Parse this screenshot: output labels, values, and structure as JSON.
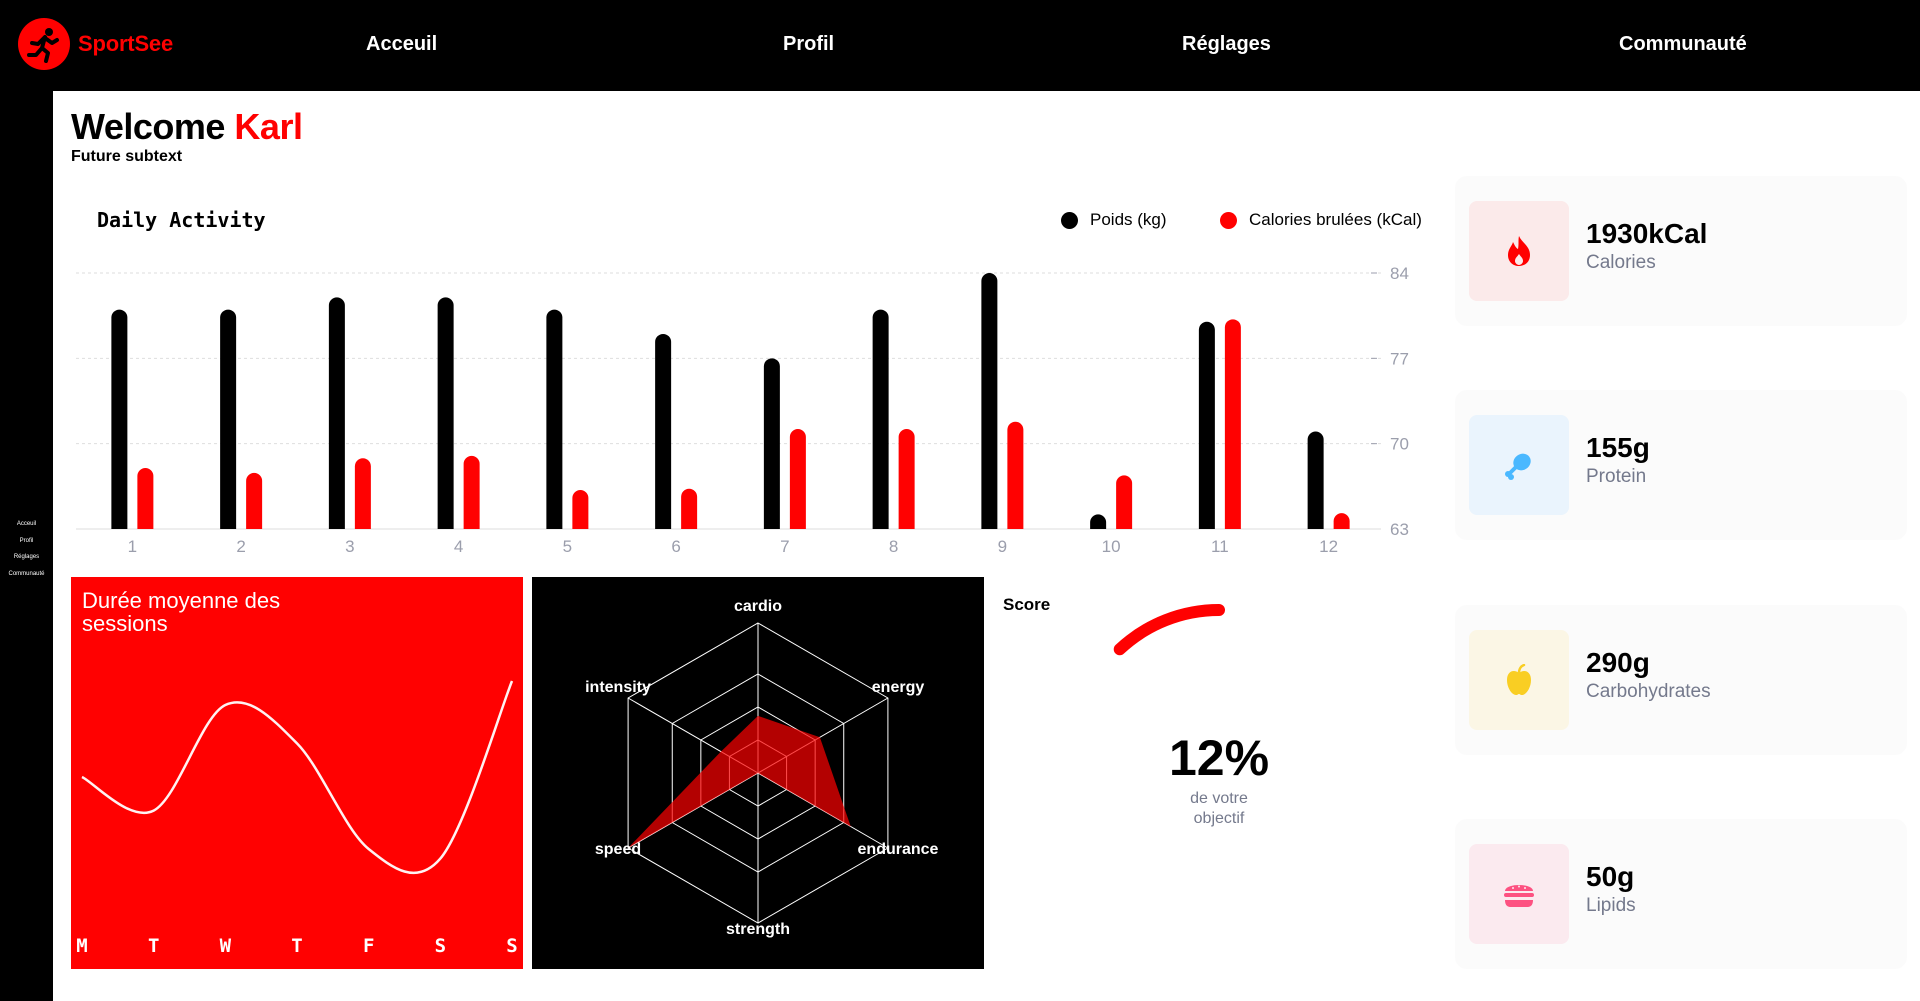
{
  "brand": {
    "name": "SportSee"
  },
  "nav": {
    "items": [
      "Acceuil",
      "Profil",
      "Réglages",
      "Communauté"
    ]
  },
  "sidebar": {
    "items": [
      "Acceuil",
      "Profil",
      "Réglages",
      "Communauté"
    ]
  },
  "header": {
    "welcome": "Welcome",
    "name": "Karl",
    "subtext": "Future subtext"
  },
  "colors": {
    "accent": "#ff0101",
    "dark": "#000000",
    "muted": "#74798c"
  },
  "activity": {
    "title": "Daily Activity",
    "legend": {
      "weight": "Poids (kg)",
      "calories": "Calories brulées (kCal)"
    }
  },
  "sessions": {
    "title": "Durée moyenne des sessions"
  },
  "score": {
    "title": "Score",
    "value": "12%",
    "caption_line1": "de votre",
    "caption_line2": "objectif",
    "fraction": 0.12
  },
  "key_data": [
    {
      "value": "1930kCal",
      "label": "Calories",
      "icon": "flame-icon",
      "color": "#ff0000",
      "bg": "#fbeaea"
    },
    {
      "value": "155g",
      "label": "Protein",
      "icon": "chicken-icon",
      "color": "#4ab8ff",
      "bg": "#eaf4fd"
    },
    {
      "value": "290g",
      "label": "Carbohydrates",
      "icon": "apple-icon",
      "color": "#f9ce23",
      "bg": "#fbf6e5"
    },
    {
      "value": "50g",
      "label": "Lipids",
      "icon": "burger-icon",
      "color": "#fd5181",
      "bg": "#fbeaef"
    }
  ],
  "chart_data": [
    {
      "type": "bar",
      "title": "Daily Activity",
      "categories": [
        "1",
        "2",
        "3",
        "4",
        "5",
        "6",
        "7",
        "8",
        "9",
        "10",
        "11",
        "12"
      ],
      "series": [
        {
          "name": "Poids (kg)",
          "values": [
            81,
            81,
            82,
            82,
            81,
            79,
            77,
            81,
            84,
            64.2,
            80,
            71
          ],
          "color": "#000000"
        },
        {
          "name": "Calories brulées (kCal)",
          "values": [
            68,
            67.6,
            68.8,
            69,
            66.2,
            66.3,
            71.2,
            71.2,
            71.8,
            67.4,
            80.2,
            64.3
          ],
          "color": "#ff0101"
        }
      ],
      "y_ticks": [
        63,
        70,
        77,
        84
      ],
      "ylim": [
        63,
        84
      ],
      "grid": true,
      "legend": "top-right"
    },
    {
      "type": "line",
      "title": "Durée moyenne des sessions",
      "categories": [
        "M",
        "T",
        "W",
        "T",
        "F",
        "S",
        "S"
      ],
      "values": [
        35,
        28,
        50,
        42,
        20,
        18,
        55
      ],
      "legend": "none"
    },
    {
      "type": "radar",
      "categories": [
        "cardio",
        "energy",
        "endurance",
        "strength",
        "speed",
        "intensity"
      ],
      "values": [
        160,
        200,
        300,
        0,
        420,
        120
      ],
      "max": 420
    },
    {
      "type": "radial",
      "title": "Score",
      "values": [
        0.12
      ]
    }
  ]
}
